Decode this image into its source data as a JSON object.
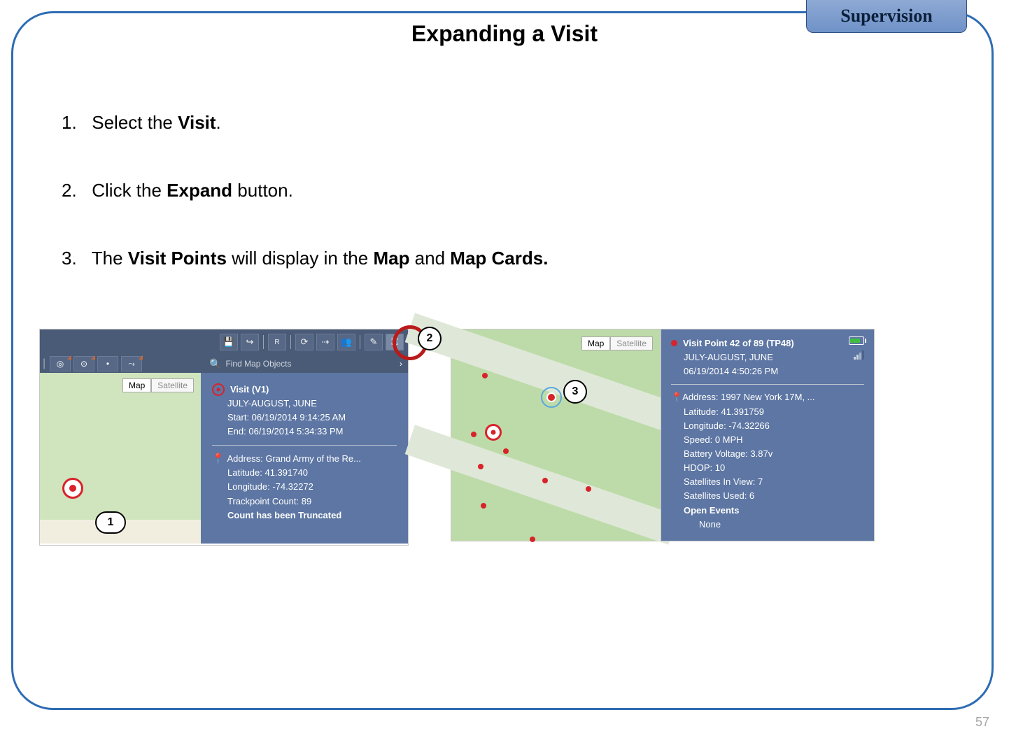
{
  "header": {
    "tab": "Supervision",
    "title": "Expanding a Visit"
  },
  "steps": {
    "s1_pre": "Select the ",
    "s1_b": "Visit",
    "s1_post": ".",
    "s2_pre": "Click the ",
    "s2_b": "Expand",
    "s2_post": " button.",
    "s3_pre": "The ",
    "s3_b1": "Visit Points",
    "s3_mid": " will display in the ",
    "s3_b2": "Map",
    "s3_and": " and ",
    "s3_b3": "Map Cards."
  },
  "callouts": {
    "c1": "1",
    "c2": "2",
    "c3": "3"
  },
  "map_toggle": {
    "map": "Map",
    "sat": "Satellite"
  },
  "search": {
    "placeholder": "Find Map Objects"
  },
  "visit_card": {
    "title": "Visit (V1)",
    "name": "JULY-AUGUST, JUNE",
    "start": "Start: 06/19/2014 9:14:25 AM",
    "end": "End: 06/19/2014 5:34:33 PM",
    "address": "Address: Grand Army of the Re...",
    "lat": "Latitude: 41.391740",
    "lon": "Longitude: -74.32272",
    "tp": "Trackpoint Count: 89",
    "trunc": "Count has been Truncated"
  },
  "detail_card": {
    "title": "Visit Point 42 of 89 (TP48)",
    "name": "JULY-AUGUST, JUNE",
    "time": "06/19/2014 4:50:26 PM",
    "address": "Address: 1997 New York 17M, ...",
    "lat": "Latitude: 41.391759",
    "lon": "Longitude: -74.32266",
    "speed": "Speed: 0 MPH",
    "batt": "Battery Voltage: 3.87v",
    "hdop": "HDOP: 10",
    "siv": "Satellites In View: 7",
    "su": "Satellites Used: 6",
    "oe": "Open Events",
    "none": "None"
  },
  "page_number": "57"
}
